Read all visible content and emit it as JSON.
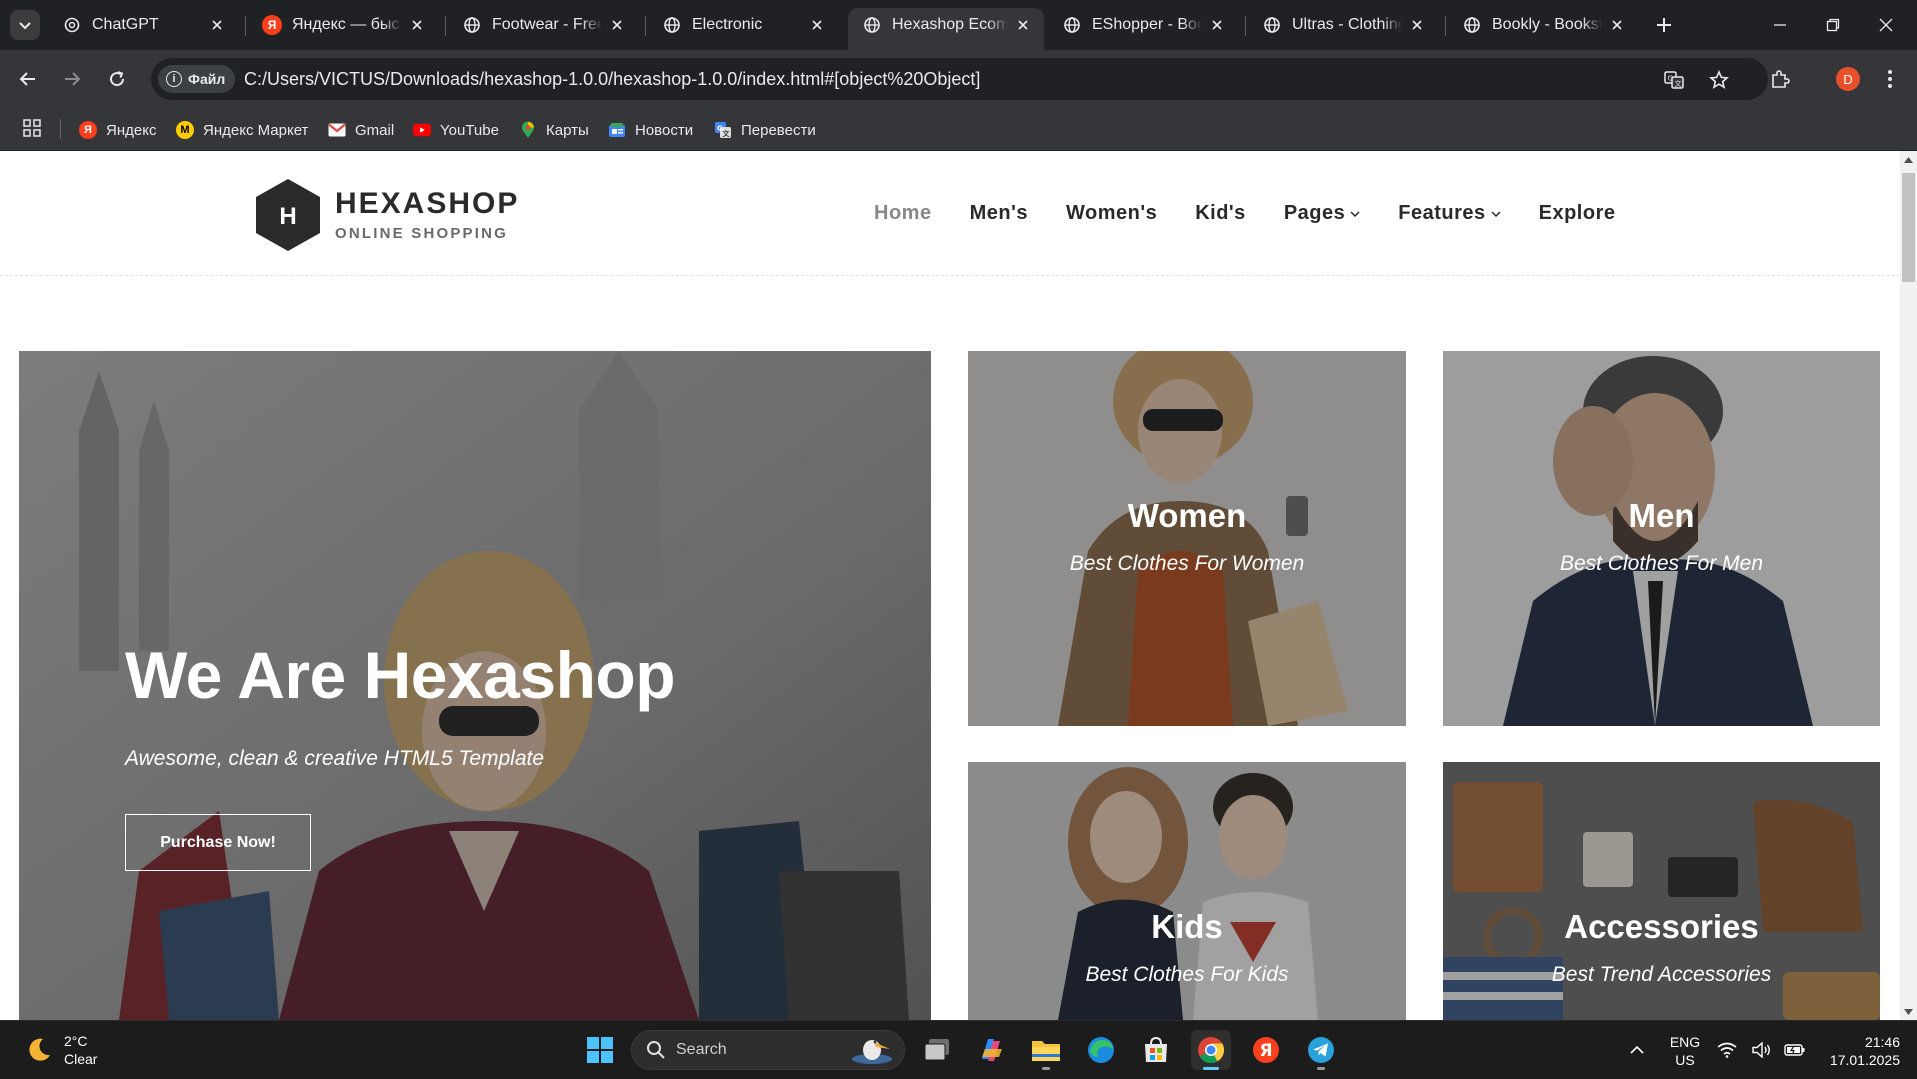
{
  "browser": {
    "tabs": [
      {
        "title": "ChatGPT",
        "favicon": "chatgpt-icon"
      },
      {
        "title": "Яндекс — быстрый поиск",
        "favicon": "yandex-icon"
      },
      {
        "title": "Footwear - Free Bootstrap",
        "favicon": "globe-icon"
      },
      {
        "title": "Electronic",
        "favicon": "globe-icon"
      },
      {
        "title": "Hexashop Ecommerce",
        "favicon": "globe-icon",
        "active": true
      },
      {
        "title": "EShopper - Bootstrap",
        "favicon": "globe-icon"
      },
      {
        "title": "Ultras - Clothing Store",
        "favicon": "globe-icon"
      },
      {
        "title": "Bookly - Bookstore",
        "favicon": "globe-icon"
      }
    ],
    "address": {
      "chip_label": "Файл",
      "url": "C:/Users/VICTUS/Downloads/hexashop-1.0.0/hexashop-1.0.0/index.html#[object%20Object]"
    },
    "profile_initial": "D",
    "bookmarks": [
      {
        "label": "Яндекс",
        "icon": "yandex-icon"
      },
      {
        "label": "Яндекс Маркет",
        "icon": "yandex-market-icon"
      },
      {
        "label": "Gmail",
        "icon": "gmail-icon"
      },
      {
        "label": "YouTube",
        "icon": "youtube-icon"
      },
      {
        "label": "Карты",
        "icon": "maps-icon"
      },
      {
        "label": "Новости",
        "icon": "news-icon"
      },
      {
        "label": "Перевести",
        "icon": "translate-icon"
      }
    ]
  },
  "site": {
    "logo": {
      "letter": "H",
      "name": "HEXASHOP",
      "tagline": "ONLINE SHOPPING"
    },
    "menu": [
      {
        "label": "Home",
        "active": true
      },
      {
        "label": "Men's"
      },
      {
        "label": "Women's"
      },
      {
        "label": "Kid's"
      },
      {
        "label": "Pages",
        "dropdown": true
      },
      {
        "label": "Features",
        "dropdown": true
      },
      {
        "label": "Explore"
      }
    ],
    "hero": {
      "title": "We Are Hexashop",
      "subtitle": "Awesome, clean & creative HTML5 Template",
      "button": "Purchase Now!"
    },
    "categories": [
      {
        "title": "Women",
        "subtitle": "Best Clothes For Women"
      },
      {
        "title": "Men",
        "subtitle": "Best Clothes For Men"
      },
      {
        "title": "Kids",
        "subtitle": "Best Clothes For Kids"
      },
      {
        "title": "Accessories",
        "subtitle": "Best Trend Accessories"
      }
    ]
  },
  "taskbar": {
    "weather": {
      "temp": "2°C",
      "condition": "Clear"
    },
    "search_placeholder": "Search",
    "language": {
      "line1": "ENG",
      "line2": "US"
    },
    "clock": {
      "time": "21:46",
      "date": "17.01.2025"
    }
  },
  "colors": {
    "chrome_dark": "#202124",
    "chrome_toolbar": "#35363a",
    "site_text": "#2a2a2a",
    "taskbar": "#1c1c1c",
    "accent": "#60cdff"
  }
}
